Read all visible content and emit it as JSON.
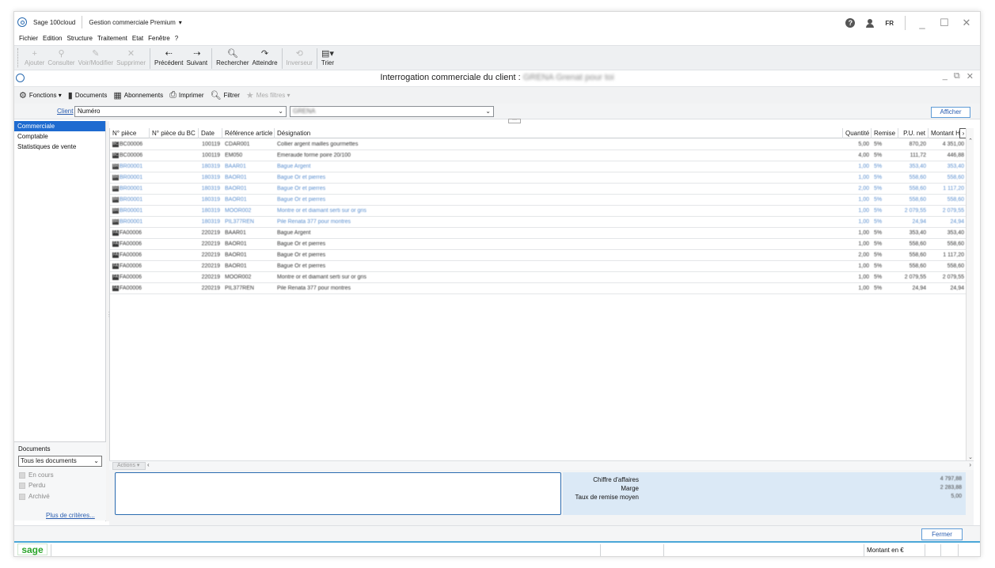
{
  "titlebar": {
    "app_name": "Sage 100cloud",
    "product": "Gestion commerciale Premium",
    "chevron": "▾",
    "language": "FR"
  },
  "menu": [
    "Fichier",
    "Edition",
    "Structure",
    "Traitement",
    "Etat",
    "Fenêtre",
    "?"
  ],
  "toolbar": {
    "buttons": [
      {
        "label": "Ajouter",
        "icon": "plus-icon",
        "glyph": "+",
        "disabled": true
      },
      {
        "label": "Consulter",
        "icon": "search-icon",
        "glyph": "⚲",
        "disabled": true
      },
      {
        "label": "Voir/Modifier",
        "icon": "pencil-icon",
        "glyph": "✎",
        "disabled": true
      },
      {
        "label": "Supprimer",
        "icon": "delete-icon",
        "glyph": "✕",
        "disabled": true
      },
      {
        "label": "Précédent",
        "icon": "arrow-left-icon",
        "glyph": "⇠",
        "disabled": false
      },
      {
        "label": "Suivant",
        "icon": "arrow-right-icon",
        "glyph": "⇢",
        "disabled": false
      },
      {
        "label": "Rechercher",
        "icon": "magnifier-icon",
        "glyph": "🔍︎",
        "disabled": false
      },
      {
        "label": "Atteindre",
        "icon": "goto-icon",
        "glyph": "↷",
        "disabled": false
      },
      {
        "label": "Inverseur",
        "icon": "invert-icon",
        "glyph": "⟲",
        "disabled": true
      },
      {
        "label": "Trier",
        "icon": "sort-icon",
        "glyph": "▤▾",
        "disabled": false
      }
    ]
  },
  "inner": {
    "caption_prefix": "Interrogation commerciale du client :",
    "caption_client": "GRENA Grenat pour toi",
    "function_bar": [
      {
        "label": "Fonctions ▾",
        "icon": "gear-icon",
        "glyph": "⚙",
        "disabled": false
      },
      {
        "label": "Documents",
        "icon": "document-icon",
        "glyph": "▮",
        "disabled": false
      },
      {
        "label": "Abonnements",
        "icon": "calendar-icon",
        "glyph": "▦",
        "disabled": false
      },
      {
        "label": "Imprimer",
        "icon": "printer-icon",
        "glyph": "⎙",
        "disabled": false
      },
      {
        "label": "Filtrer",
        "icon": "filter-icon",
        "glyph": "🔍︎",
        "disabled": false
      },
      {
        "label": "Mes filtres ▾",
        "icon": "star-icon",
        "glyph": "★",
        "disabled": true
      }
    ],
    "client_label": "Client",
    "client_field": "Numéro",
    "client_value": "GRENA",
    "afficher": "Afficher"
  },
  "leftnav": {
    "items": [
      "Commerciale",
      "Comptable",
      "Statistiques de vente"
    ],
    "selected": 0,
    "documents_label": "Documents",
    "documents_filter": "Tous les documents",
    "checks": [
      "En cours",
      "Perdu",
      "Archivé"
    ],
    "more_criteria": "Plus de critères..."
  },
  "grid": {
    "columns": [
      "N° pièce",
      "N° pièce du BC",
      "Date",
      "Référence article",
      "Désignation",
      "Quantité",
      "Remise",
      "P.U. net",
      "Montant HT"
    ],
    "rows": [
      {
        "type": "BC",
        "piece": "BC00006",
        "bc": "",
        "date": "100119",
        "ref": "CDAR001",
        "des": "Collier argent mailles gourmettes",
        "qty": "5,00",
        "rem": "5%",
        "pu": "870,20",
        "mt": "4 351,00",
        "tone": "dark"
      },
      {
        "type": "BC",
        "piece": "BC00006",
        "bc": "",
        "date": "100119",
        "ref": "EM050",
        "des": "Emeraude forme poire 20/100",
        "qty": "4,00",
        "rem": "5%",
        "pu": "111,72",
        "mt": "446,88",
        "tone": "dark"
      },
      {
        "type": "BR",
        "piece": "BR00001",
        "bc": "",
        "date": "180319",
        "ref": "BAAR01",
        "des": "Bague Argent",
        "qty": "1,00",
        "rem": "5%",
        "pu": "353,40",
        "mt": "353,40",
        "tone": "light"
      },
      {
        "type": "BR",
        "piece": "BR00001",
        "bc": "",
        "date": "180319",
        "ref": "BAOR01",
        "des": "Bague Or et pierres",
        "qty": "1,00",
        "rem": "5%",
        "pu": "558,60",
        "mt": "558,60",
        "tone": "light"
      },
      {
        "type": "BR",
        "piece": "BR00001",
        "bc": "",
        "date": "180319",
        "ref": "BAOR01",
        "des": "Bague Or et pierres",
        "qty": "2,00",
        "rem": "5%",
        "pu": "558,60",
        "mt": "1 117,20",
        "tone": "light"
      },
      {
        "type": "BR",
        "piece": "BR00001",
        "bc": "",
        "date": "180319",
        "ref": "BAOR01",
        "des": "Bague Or et pierres",
        "qty": "1,00",
        "rem": "5%",
        "pu": "558,60",
        "mt": "558,60",
        "tone": "light"
      },
      {
        "type": "BR",
        "piece": "BR00001",
        "bc": "",
        "date": "180319",
        "ref": "MOOR002",
        "des": "Montre or et diamant serti sur or gris",
        "qty": "1,00",
        "rem": "5%",
        "pu": "2 079,55",
        "mt": "2 079,55",
        "tone": "light"
      },
      {
        "type": "BR",
        "piece": "BR00001",
        "bc": "",
        "date": "180319",
        "ref": "PIL377REN",
        "des": "Pile Renata 377 pour montres",
        "qty": "1,00",
        "rem": "5%",
        "pu": "24,94",
        "mt": "24,94",
        "tone": "light"
      },
      {
        "type": "FA",
        "piece": "FA00006",
        "bc": "",
        "date": "220219",
        "ref": "BAAR01",
        "des": "Bague Argent",
        "qty": "1,00",
        "rem": "5%",
        "pu": "353,40",
        "mt": "353,40",
        "tone": "dark"
      },
      {
        "type": "FA",
        "piece": "FA00006",
        "bc": "",
        "date": "220219",
        "ref": "BAOR01",
        "des": "Bague Or et pierres",
        "qty": "1,00",
        "rem": "5%",
        "pu": "558,60",
        "mt": "558,60",
        "tone": "dark"
      },
      {
        "type": "FA",
        "piece": "FA00006",
        "bc": "",
        "date": "220219",
        "ref": "BAOR01",
        "des": "Bague Or et pierres",
        "qty": "2,00",
        "rem": "5%",
        "pu": "558,60",
        "mt": "1 117,20",
        "tone": "dark"
      },
      {
        "type": "FA",
        "piece": "FA00006",
        "bc": "",
        "date": "220219",
        "ref": "BAOR01",
        "des": "Bague Or et pierres",
        "qty": "1,00",
        "rem": "5%",
        "pu": "558,60",
        "mt": "558,60",
        "tone": "dark"
      },
      {
        "type": "FA",
        "piece": "FA00006",
        "bc": "",
        "date": "220219",
        "ref": "MOOR002",
        "des": "Montre or et diamant serti sur or gris",
        "qty": "1,00",
        "rem": "5%",
        "pu": "2 079,55",
        "mt": "2 079,55",
        "tone": "dark"
      },
      {
        "type": "FA",
        "piece": "FA00006",
        "bc": "",
        "date": "220219",
        "ref": "PIL377REN",
        "des": "Pile Renata 377 pour montres",
        "qty": "1,00",
        "rem": "5%",
        "pu": "24,94",
        "mt": "24,94",
        "tone": "dark"
      }
    ],
    "actions": "Actions ▾"
  },
  "totals": {
    "labels": [
      "Chiffre d'affaires",
      "Marge",
      "Taux de remise moyen"
    ],
    "values": [
      "4 797,88",
      "2 283,88",
      "5,00"
    ]
  },
  "footer": {
    "fermer": "Fermer",
    "status_logo": "sage",
    "status_currency": "Montant en €"
  }
}
